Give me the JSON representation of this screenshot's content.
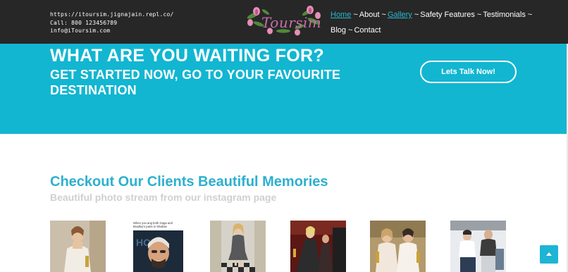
{
  "header": {
    "contact": {
      "website": "https://itoursim.jignajain.repl.co/",
      "phone": "Call: 800 123456789",
      "email": "info@iToursim.com"
    },
    "logo": {
      "text": "Toursim"
    },
    "nav": {
      "separator": "~",
      "items": [
        {
          "label": "Home",
          "active": true
        },
        {
          "label": "About",
          "active": false
        },
        {
          "label": "Gallery",
          "active": true
        },
        {
          "label": "Safety Features",
          "active": false
        },
        {
          "label": "Testimonials",
          "active": false
        },
        {
          "label": "Blog",
          "active": false
        },
        {
          "label": "Contact",
          "active": false
        }
      ]
    }
  },
  "banner": {
    "title": "WHAT ARE YOU WAITING FOR?",
    "subtitle": "GET STARTED NOW, GO TO YOUR FAVOURITE DESTINATION",
    "cta_label": "Lets Talk Now!"
  },
  "gallery": {
    "title": "Checkout Our Clients Beautiful Memories",
    "subtitle": "Beautiful photo stream from our instagram page",
    "photo2_caption": "When you ang both Gaga and Bradley's parts in Shallow"
  },
  "colors": {
    "header_bg": "#272727",
    "accent": "#12b6d1",
    "title_blue": "#2db0cf",
    "subtitle_gray": "#d0d0d0"
  },
  "icons": {
    "scroll_top": "arrow-up-icon"
  }
}
